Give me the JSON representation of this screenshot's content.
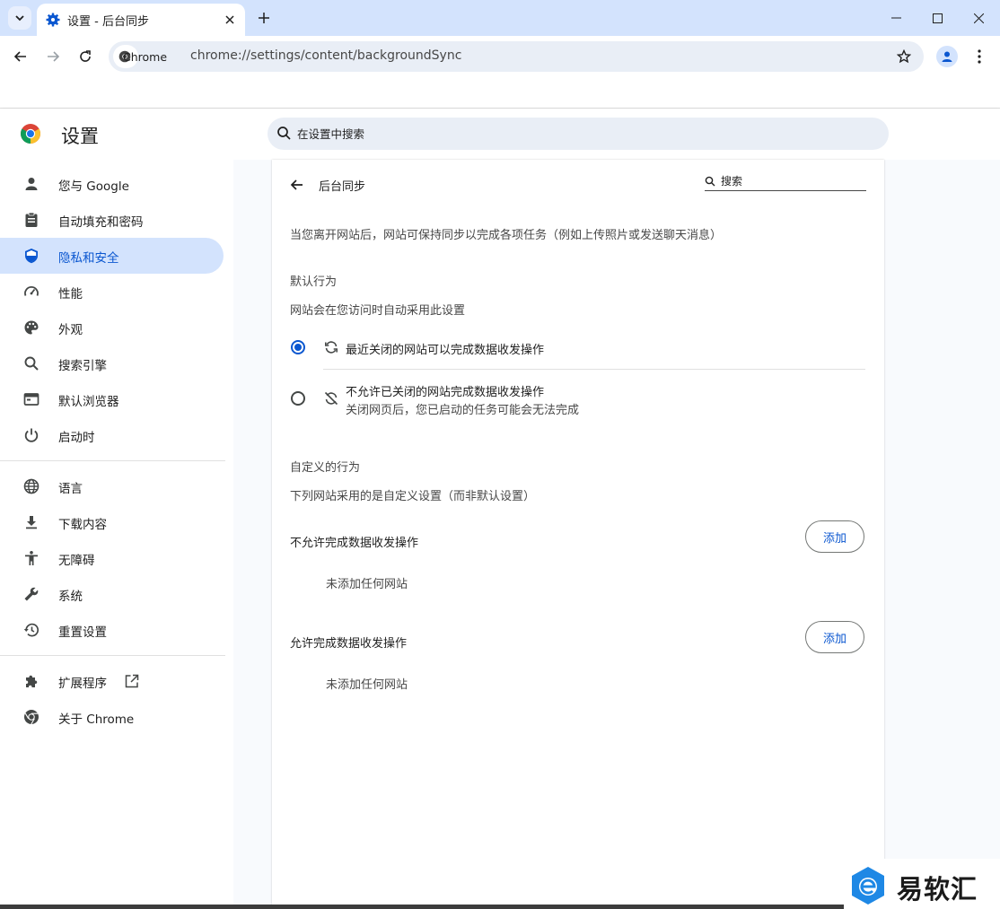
{
  "browser": {
    "tab_title": "设置 - 后台同步",
    "chip_label": "Chrome",
    "url": "chrome://settings/content/backgroundSync"
  },
  "settings": {
    "title": "设置",
    "search_placeholder": "在设置中搜索"
  },
  "sidebar": {
    "items": [
      {
        "label": "您与 Google",
        "icon": "person-icon"
      },
      {
        "label": "自动填充和密码",
        "icon": "clipboard-icon"
      },
      {
        "label": "隐私和安全",
        "icon": "shield-icon"
      },
      {
        "label": "性能",
        "icon": "speedometer-icon"
      },
      {
        "label": "外观",
        "icon": "palette-icon"
      },
      {
        "label": "搜索引擎",
        "icon": "search-icon"
      },
      {
        "label": "默认浏览器",
        "icon": "browser-icon"
      },
      {
        "label": "启动时",
        "icon": "power-icon"
      },
      {
        "label": "语言",
        "icon": "globe-icon"
      },
      {
        "label": "下载内容",
        "icon": "download-icon"
      },
      {
        "label": "无障碍",
        "icon": "accessibility-icon"
      },
      {
        "label": "系统",
        "icon": "wrench-icon"
      },
      {
        "label": "重置设置",
        "icon": "history-icon"
      },
      {
        "label": "扩展程序",
        "icon": "puzzle-icon"
      },
      {
        "label": "关于 Chrome",
        "icon": "chrome-icon"
      }
    ],
    "active_index": 2
  },
  "page": {
    "title": "后台同步",
    "search_placeholder": "搜索",
    "description": "当您离开网站后，网站可保持同步以完成各项任务（例如上传照片或发送聊天消息）",
    "default_heading": "默认行为",
    "default_sub": "网站会在您访问时自动采用此设置",
    "option_allow": "最近关闭的网站可以完成数据收发操作",
    "option_block": "不允许已关闭的网站完成数据收发操作",
    "option_block_sub": "关闭网页后，您已启动的任务可能会无法完成",
    "selected_option": "allow",
    "custom_heading": "自定义的行为",
    "custom_sub": "下列网站采用的是自定义设置（而非默认设置）",
    "block_list_title": "不允许完成数据收发操作",
    "block_list_empty": "未添加任何网站",
    "allow_list_title": "允许完成数据收发操作",
    "allow_list_empty": "未添加任何网站",
    "add_label": "添加"
  },
  "watermark": {
    "text": "易软汇"
  },
  "colors": {
    "accent": "#0b57d0",
    "active_nav_bg": "#d3e3fd",
    "titlebar": "#d3e3fd"
  }
}
